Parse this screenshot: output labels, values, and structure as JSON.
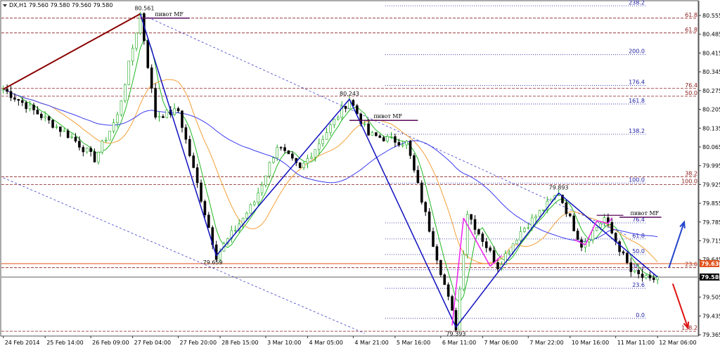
{
  "chart_data": {
    "type": "candlestick",
    "title": "DX,H1  79.560 79.580 79.560 79.580",
    "symbol": "DX,H1",
    "ohlc": [
      79.56,
      79.58,
      79.56,
      79.58
    ],
    "ylim": [
      79.36,
      80.61
    ],
    "y_ticks": [
      80.555,
      80.485,
      80.415,
      80.345,
      80.275,
      80.205,
      80.135,
      80.065,
      79.995,
      79.925,
      79.855,
      79.785,
      79.715,
      79.645,
      79.575,
      79.505,
      79.435,
      79.365
    ],
    "y_tick_labels": [
      "80.555",
      "80.485",
      "80.415",
      "80.345",
      "80.275",
      "80.205",
      "80.135",
      "80.065",
      "79.995",
      "79.925",
      "79.855",
      "79.785",
      "79.715",
      "79.645",
      "79.575",
      "79.505",
      "79.435",
      "79.365"
    ],
    "x_tick_labels": [
      "24 Feb 2014",
      "25 Feb 14:00",
      "26 Feb 09:00",
      "27 Feb 04:00",
      "27 Feb 20:00",
      "28 Feb 15:00",
      "3 Mar 10:00",
      "4 Mar 05:00",
      "4 Mar 21:00",
      "5 Mar 16:00",
      "6 Mar 11:00",
      "7 Mar 06:00",
      "7 Mar 22:00",
      "10 Mar 16:00",
      "11 Mar 11:00",
      "12 Mar 06:00"
    ],
    "n_bars": 183,
    "price_markers": [
      {
        "label": "79.630",
        "value": 79.63,
        "color": "#e2501a"
      },
      {
        "label": "79.580",
        "value": 79.58,
        "color": "#000000"
      }
    ],
    "swing_points": [
      {
        "label": "80.561",
        "bar": 36,
        "value": 80.561
      },
      {
        "label": "79.659",
        "bar": 56,
        "value": 79.659
      },
      {
        "label": "80.243",
        "bar": 91,
        "value": 80.243
      },
      {
        "label": "79.393",
        "bar": 119,
        "value": 79.393
      },
      {
        "label": "79.893",
        "bar": 146,
        "value": 79.893
      }
    ],
    "pivot_labels": [
      {
        "label": "пивот MF",
        "value": 80.545
      },
      {
        "label": "пивот MF",
        "value": 80.164
      },
      {
        "label": "пивот MF",
        "value": 79.803
      }
    ],
    "fib_levels": [
      {
        "label": "238.2",
        "value": 80.591,
        "color": "#1a1aa0",
        "style": "dotted"
      },
      {
        "label": "200.0",
        "value": 80.409,
        "color": "#1a1aa0",
        "style": "dotted"
      },
      {
        "label": "176.4",
        "value": 80.294,
        "color": "#1a1aa0",
        "style": "dotted"
      },
      {
        "label": "161.8",
        "value": 80.225,
        "color": "#1a1aa0",
        "style": "dotted"
      },
      {
        "label": "138.2",
        "value": 80.112,
        "color": "#1a1aa0",
        "style": "dotted"
      },
      {
        "label": "100.0",
        "value": 79.93,
        "color": "#1a1aa0",
        "style": "dotted"
      },
      {
        "label": "76.4",
        "value": 79.782,
        "color": "#1a1aa0",
        "style": "dotted"
      },
      {
        "label": "61.8",
        "value": 79.722,
        "color": "#1a1aa0",
        "style": "dotted"
      },
      {
        "label": "50.0",
        "value": 79.664,
        "color": "#1a1aa0",
        "style": "dotted"
      },
      {
        "label": "38.2",
        "value": 79.607,
        "color": "#1a1aa0",
        "style": "dotted"
      },
      {
        "label": "23.6",
        "value": 79.538,
        "color": "#1a1aa0",
        "style": "dotted"
      },
      {
        "label": "0.0",
        "value": 79.426,
        "color": "#1a1aa0",
        "style": "dotted"
      }
    ],
    "fib_levels_red": [
      {
        "label": "61.8",
        "value": 80.545,
        "color": "#8b1a1a"
      },
      {
        "label": "61.8",
        "value": 80.49,
        "color": "#8b1a1a"
      },
      {
        "label": "76.4",
        "value": 80.283,
        "color": "#8b1a1a"
      },
      {
        "label": "50.0",
        "value": 80.254,
        "color": "#8b1a1a"
      },
      {
        "label": "38.2",
        "value": 79.954,
        "color": "#8b1a1a"
      },
      {
        "label": "100.0",
        "value": 79.925,
        "color": "#8b1a1a"
      },
      {
        "label": "23.6",
        "value": 79.615,
        "color": "#8b1a1a"
      },
      {
        "label": "138.2",
        "value": 79.378,
        "color": "#8b1a1a"
      }
    ],
    "series": [
      {
        "type": "ma",
        "color": "#22b822"
      },
      {
        "type": "ma",
        "color": "#f2a03a"
      },
      {
        "type": "ma",
        "color": "#3c3cf0"
      }
    ],
    "colors": {
      "bull": "#22aa22",
      "bear": "#000000",
      "wave": "#1010c0",
      "trend": "#8b0000",
      "pink": "#ee22ee",
      "channel": "#3c3cc8",
      "arrow_up": "#2244cc",
      "arrow_down": "#dd1111",
      "pivot": "#5a0a5a"
    },
    "grid": false
  }
}
